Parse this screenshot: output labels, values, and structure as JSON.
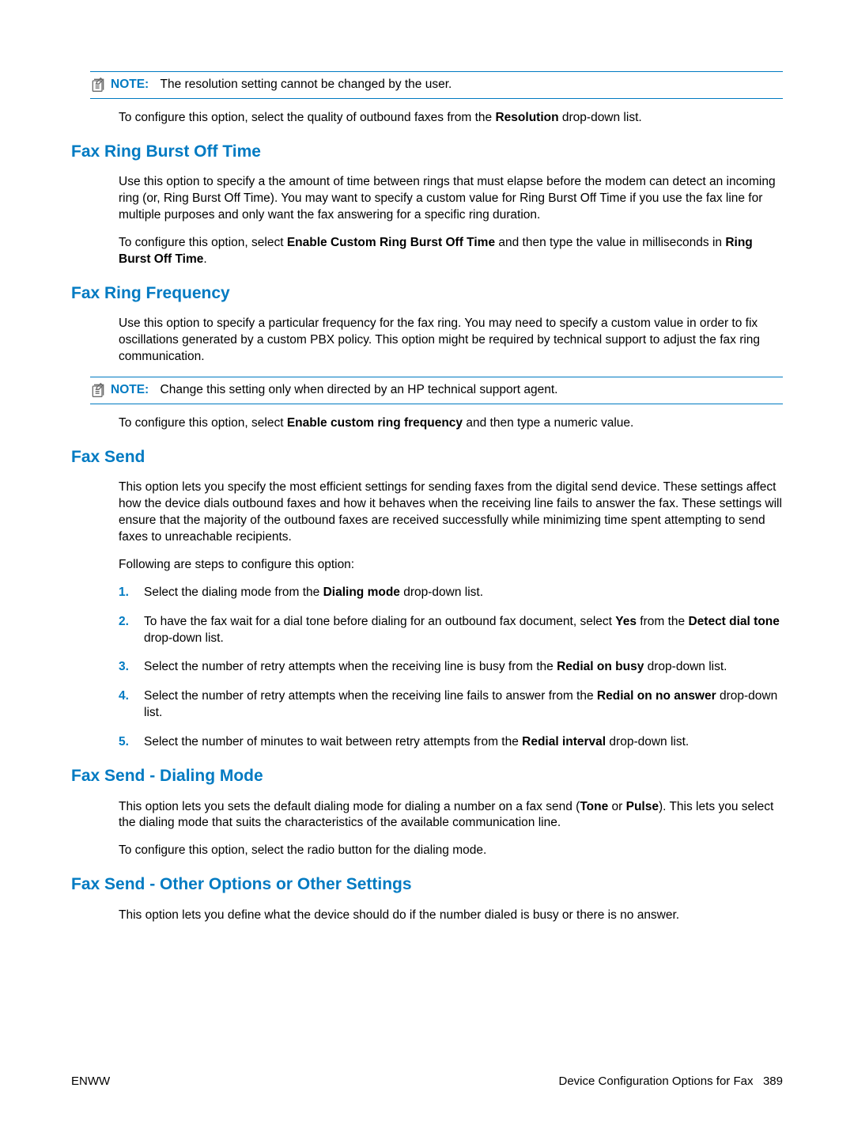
{
  "note1": {
    "label": "NOTE:",
    "text": "The resolution setting cannot be changed by the user."
  },
  "para_resolution": {
    "pre": "To configure this option, select the quality of outbound faxes from the ",
    "b1": "Resolution",
    "post": " drop-down list."
  },
  "sec_ringburst": {
    "title": "Fax Ring Burst Off Time",
    "p1": "Use this option to specify a the amount of time between rings that must elapse before the modem can detect an incoming ring (or, Ring Burst Off Time). You may want to specify a custom value for Ring Burst Off Time if you use the fax line for multiple purposes and only want the fax answering for a specific ring duration.",
    "p2_pre": "To configure this option, select ",
    "p2_b1": "Enable Custom Ring Burst Off Time",
    "p2_mid": " and then type the value in milliseconds in ",
    "p2_b2": "Ring Burst Off Time",
    "p2_post": "."
  },
  "sec_ringfreq": {
    "title": "Fax Ring Frequency",
    "p1": "Use this option to specify a particular frequency for the fax ring. You may need to specify a custom value in order to fix oscillations generated by a custom PBX policy. This option might be required by technical support to adjust the fax ring communication."
  },
  "note2": {
    "label": "NOTE:",
    "text": "Change this setting only when directed by an HP technical support agent."
  },
  "para_ringfreq_cfg": {
    "pre": "To configure this option, select ",
    "b1": "Enable custom ring frequency",
    "post": " and then type a numeric value."
  },
  "sec_faxsend": {
    "title": "Fax Send",
    "p1": "This option lets you specify the most efficient settings for sending faxes from the digital send device. These settings affect how the device dials outbound faxes and how it behaves when the receiving line fails to answer the fax. These settings will ensure that the majority of the outbound faxes are received successfully while minimizing time spent attempting to send faxes to unreachable recipients.",
    "p2": "Following are steps to configure this option:",
    "steps": {
      "s1_pre": "Select the dialing mode from the ",
      "s1_b": "Dialing mode",
      "s1_post": " drop-down list.",
      "s2_pre": "To have the fax wait for a dial tone before dialing for an outbound fax document, select ",
      "s2_b1": "Yes",
      "s2_mid": " from the ",
      "s2_b2": "Detect dial tone",
      "s2_post": " drop-down list.",
      "s3_pre": "Select the number of retry attempts when the receiving line is busy from the ",
      "s3_b": "Redial on busy",
      "s3_post": " drop-down list.",
      "s4_pre": "Select the number of retry attempts when the receiving line fails to answer from the ",
      "s4_b": "Redial on no answer",
      "s4_post": " drop-down list.",
      "s5_pre": "Select the number of minutes to wait between retry attempts from the ",
      "s5_b": "Redial interval",
      "s5_post": " drop-down list."
    },
    "nums": {
      "n1": "1.",
      "n2": "2.",
      "n3": "3.",
      "n4": "4.",
      "n5": "5."
    }
  },
  "sec_dialing": {
    "title": "Fax Send - Dialing Mode",
    "p1_pre": "This option lets you sets the default dialing mode for dialing a number on a fax send (",
    "p1_b1": "Tone",
    "p1_mid": " or ",
    "p1_b2": "Pulse",
    "p1_post": "). This lets you select the dialing mode that suits the characteristics of the available communication line.",
    "p2": "To configure this option, select the radio button for the dialing mode."
  },
  "sec_other": {
    "title": "Fax Send - Other Options or Other Settings",
    "p1": "This option lets you define what the device should do if the number dialed is busy or there is no answer."
  },
  "footer": {
    "left": "ENWW",
    "right_label": "Device Configuration Options for Fax",
    "right_page": "389"
  }
}
